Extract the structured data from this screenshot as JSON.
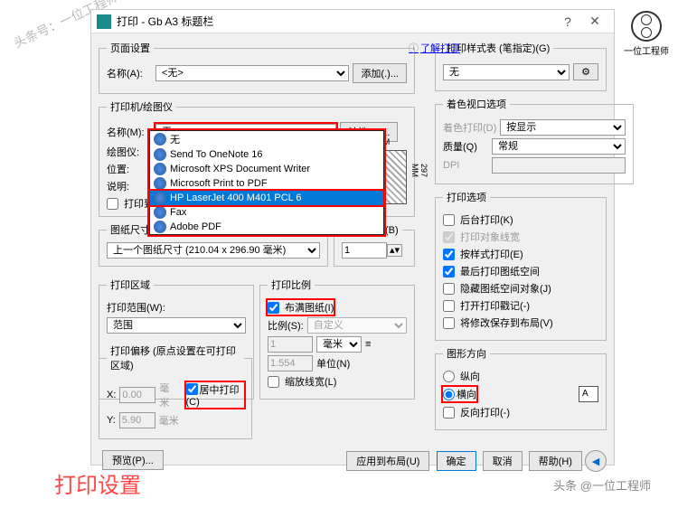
{
  "watermark_tl": "头条号：一位工程师",
  "watermark_tr_label": "一位工程师",
  "dialog": {
    "title": "打印 - Gb A3 标题栏",
    "close": "✕",
    "help_link": "了解打印"
  },
  "page_setup": {
    "legend": "页面设置",
    "name_label": "名称(A):",
    "name_value": "<无>",
    "add_btn": "添加(.)..."
  },
  "printer": {
    "legend": "打印机/绘图仪",
    "name_label": "名称(M):",
    "name_value": "无",
    "props_btn": "特性(R)...",
    "plotter_label": "绘图仪:",
    "location_label": "位置:",
    "desc_label": "说明:",
    "file_chk": "打印到文",
    "preview_w": "210 MM",
    "preview_h": "297 MM",
    "options": [
      "无",
      "Send To OneNote 16",
      "Microsoft XPS Document Writer",
      "Microsoft Print to PDF",
      "HP LaserJet 400 M401 PCL 6",
      "Fax",
      "Adobe PDF"
    ]
  },
  "paper": {
    "legend": "图纸尺寸(Z)",
    "value": "上一个图纸尺寸 (210.04 x 296.90 毫米)"
  },
  "copies": {
    "legend": "打印份数(B)",
    "value": "1"
  },
  "area": {
    "legend": "打印区域",
    "range_label": "打印范围(W):",
    "range_value": "范围"
  },
  "scale": {
    "legend": "打印比例",
    "fit_chk": "布满图纸(I)",
    "ratio_label": "比例(S):",
    "ratio_value": "自定义",
    "num1": "1",
    "unit": "毫米",
    "num2": "1.554",
    "unit2": "单位(N)",
    "scale_lw": "缩放线宽(L)"
  },
  "offset": {
    "legend": "打印偏移 (原点设置在可打印区域)",
    "x_label": "X:",
    "x_value": "0.00",
    "y_label": "Y:",
    "y_value": "5.90",
    "unit": "毫米",
    "center_chk": "居中打印(C)"
  },
  "styles": {
    "legend": "打印样式表 (笔指定)(G)",
    "value": "无"
  },
  "viewport": {
    "legend": "着色视口选项",
    "shade_label": "着色打印(D)",
    "shade_value": "按显示",
    "quality_label": "质量(Q)",
    "quality_value": "常规",
    "dpi_label": "DPI"
  },
  "options": {
    "legend": "打印选项",
    "bg": "后台打印(K)",
    "lw": "打印对象线宽",
    "style": "按样式打印(E)",
    "last": "最后打印图纸空间",
    "hide": "隐藏图纸空间对象(J)",
    "stamp": "打开打印戳记(-)",
    "save": "将修改保存到布局(V)"
  },
  "orient": {
    "legend": "图形方向",
    "portrait": "纵向",
    "landscape": "横向",
    "reverse": "反向打印(-)"
  },
  "buttons": {
    "preview": "预览(P)...",
    "apply": "应用到布局(U)",
    "ok": "确定",
    "cancel": "取消",
    "help": "帮助(H)"
  },
  "footer": "打印设置",
  "footer_src": "头条 @一位工程师"
}
